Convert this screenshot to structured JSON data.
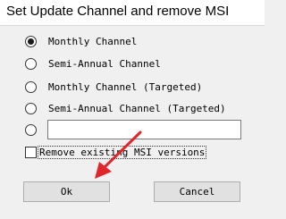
{
  "window": {
    "title": "Set Update Channel and remove MSI"
  },
  "options": {
    "monthly": "Monthly Channel",
    "semi_annual": "Semi-Annual Channel",
    "monthly_targeted": "Monthly Channel (Targeted)",
    "semi_annual_targeted": "Semi-Annual Channel (Targeted)",
    "custom_value": "",
    "selected": "monthly"
  },
  "remove_msi": {
    "label": "Remove existing MSI versions",
    "checked": false
  },
  "buttons": {
    "ok": "Ok",
    "cancel": "Cancel"
  },
  "colors": {
    "window_bg": "#f0f0f0",
    "titlebar_bg": "#ffffff",
    "annotation_arrow": "#e0262b"
  }
}
